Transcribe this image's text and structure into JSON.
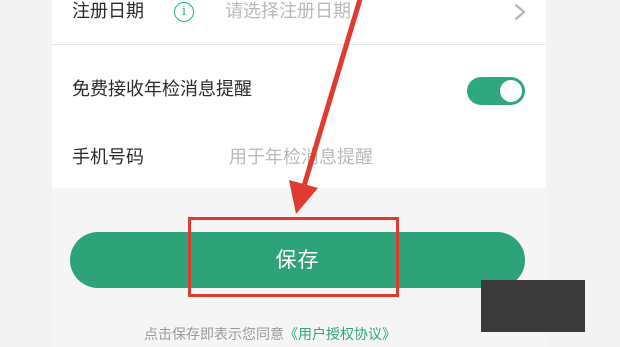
{
  "colors": {
    "accent": "#2ea37a",
    "annotation": "#e03b2f",
    "placeholder": "#b9b9b9"
  },
  "form": {
    "registration_date": {
      "label": "注册日期",
      "placeholder": "请选择注册日期",
      "icon": "info-icon"
    },
    "reminder": {
      "label": "免费接收年检消息提醒",
      "enabled": true
    },
    "phone": {
      "label": "手机号码",
      "placeholder": "用于年检消息提醒"
    }
  },
  "actions": {
    "save_label": "保存"
  },
  "agreement": {
    "prefix": "点击保存即表示您同意",
    "link": "《用户授权协议》"
  }
}
